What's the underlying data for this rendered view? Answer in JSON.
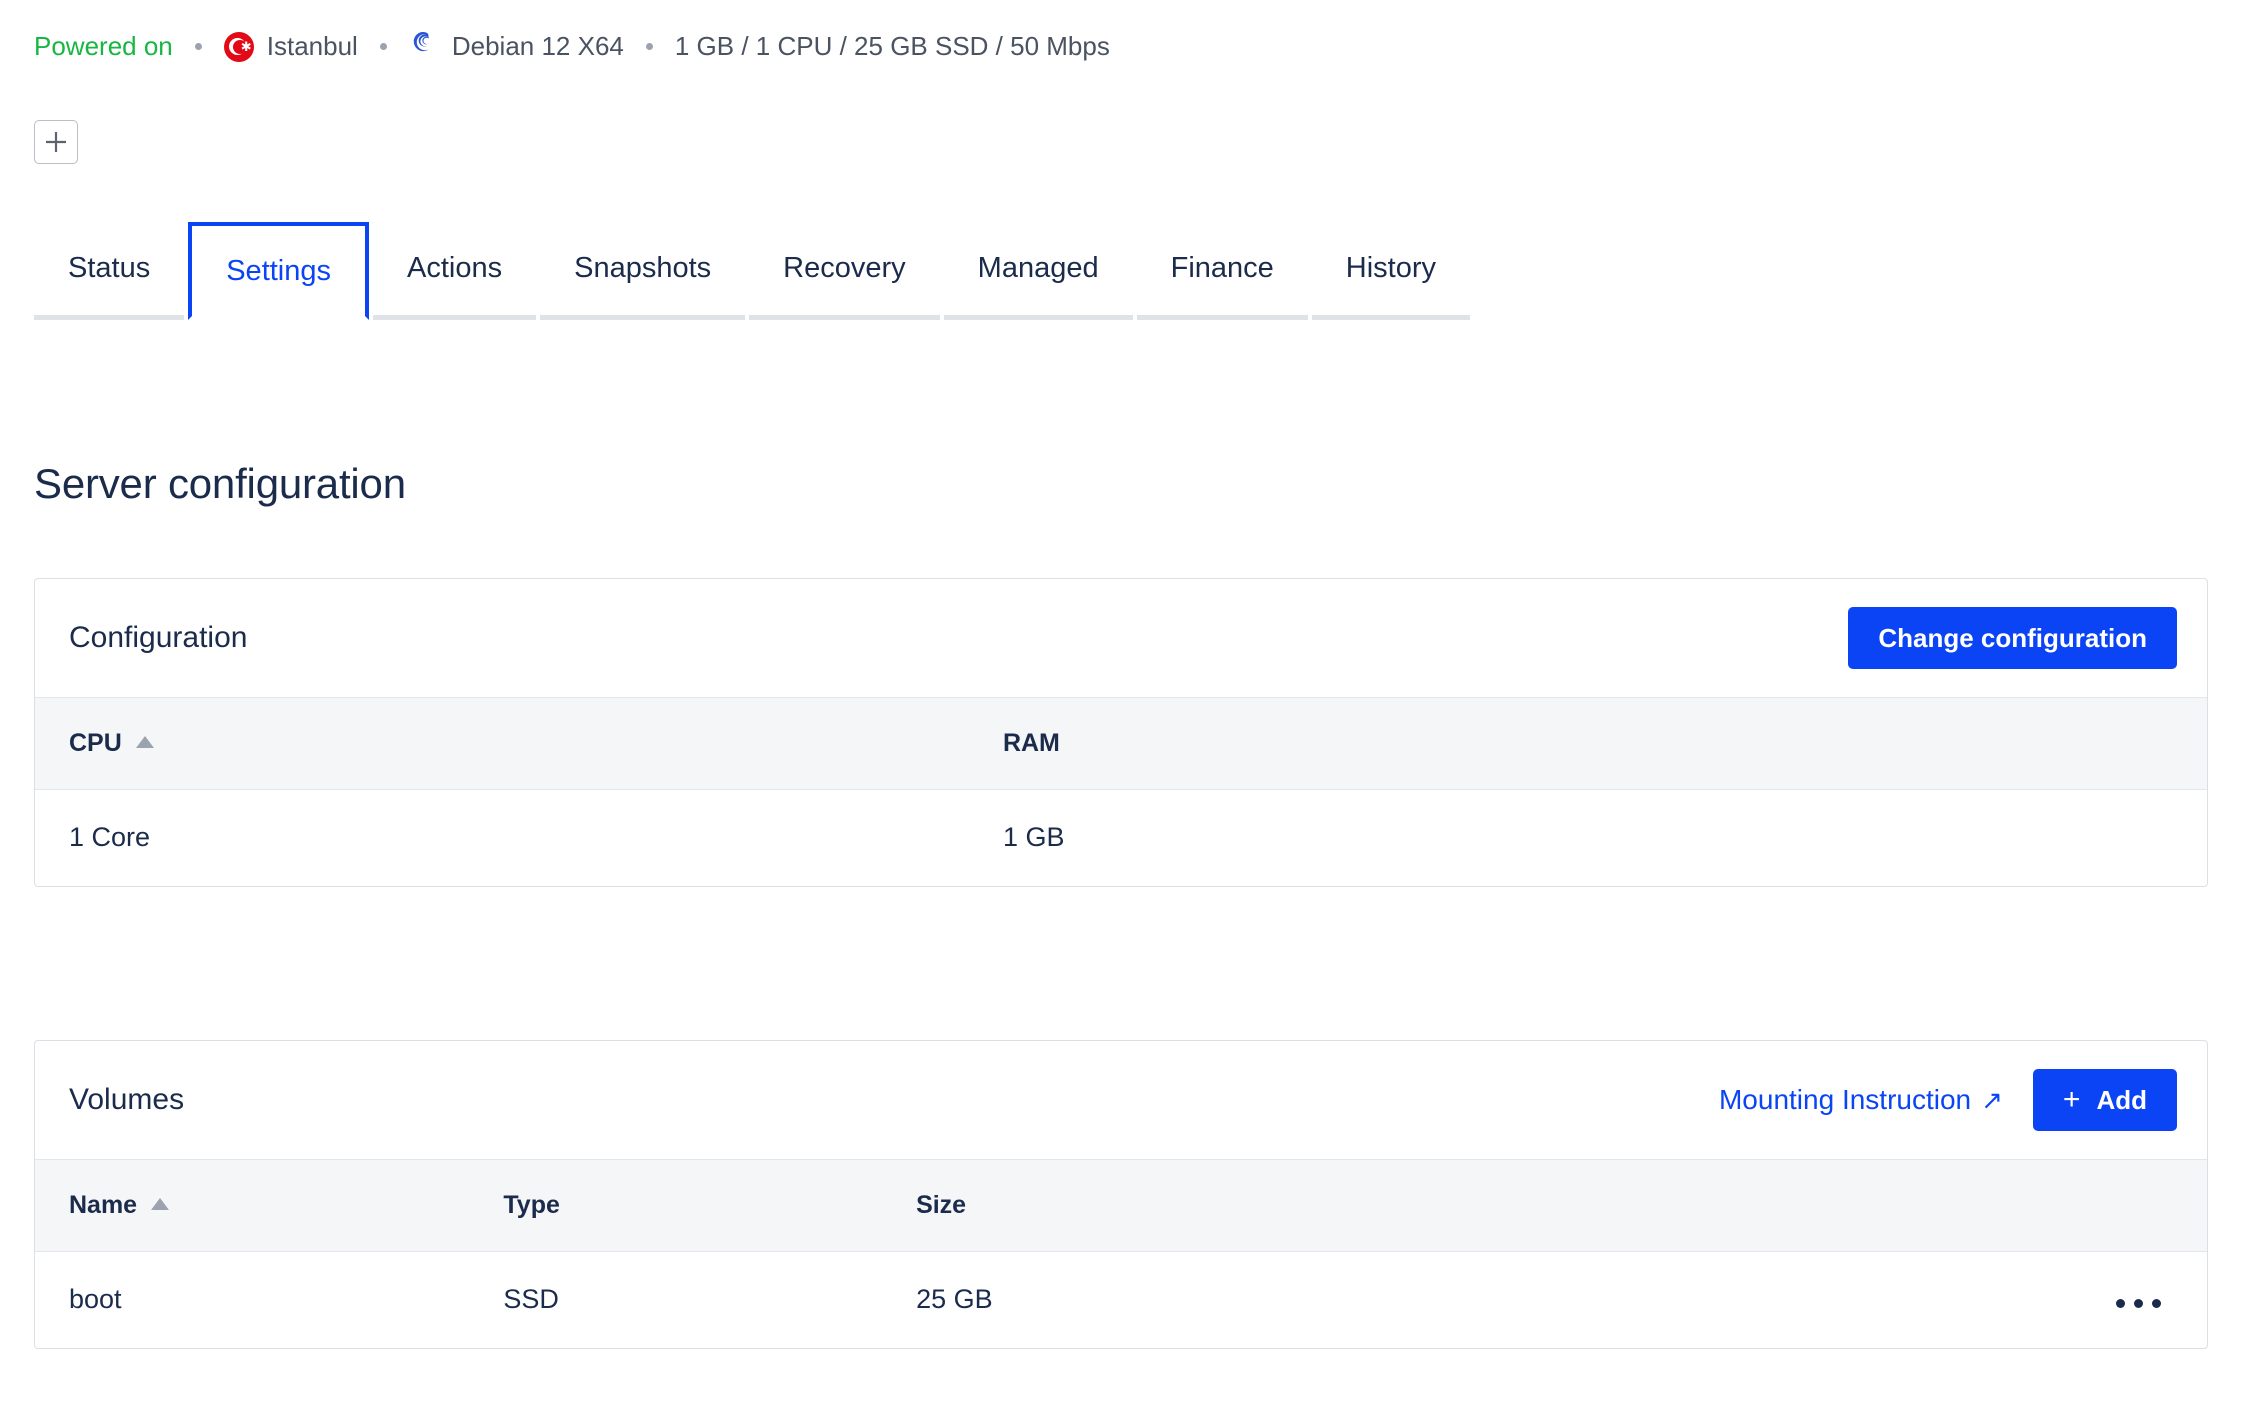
{
  "status_bar": {
    "power_state": "Powered on",
    "region": "Istanbul",
    "region_icon": "turkey-flag-icon",
    "os": "Debian 12 X64",
    "os_icon": "debian-logo-icon",
    "specs": "1 GB / 1 CPU / 25 GB SSD / 50 Mbps"
  },
  "toolbar": {
    "add_tag_label": "+",
    "add_tag_icon": "plus-icon"
  },
  "tabs": [
    {
      "label": "Status",
      "active": false
    },
    {
      "label": "Settings",
      "active": true
    },
    {
      "label": "Actions",
      "active": false
    },
    {
      "label": "Snapshots",
      "active": false
    },
    {
      "label": "Recovery",
      "active": false
    },
    {
      "label": "Managed",
      "active": false
    },
    {
      "label": "Finance",
      "active": false
    },
    {
      "label": "History",
      "active": false
    }
  ],
  "page_title": "Server configuration",
  "configuration_card": {
    "title": "Configuration",
    "change_button": "Change configuration",
    "columns": [
      "CPU",
      "RAM"
    ],
    "sorted_column": "CPU",
    "sort_direction": "asc",
    "rows": [
      {
        "cpu": "1 Core",
        "ram": "1 GB"
      }
    ]
  },
  "volumes_card": {
    "title": "Volumes",
    "mounting_link": "Mounting Instruction",
    "mounting_link_icon": "external-link-arrow-icon",
    "add_button": "Add",
    "add_button_icon": "plus-icon",
    "columns": [
      "Name",
      "Type",
      "Size"
    ],
    "sorted_column": "Name",
    "sort_direction": "asc",
    "rows": [
      {
        "name": "boot",
        "type": "SSD",
        "size": "25 GB",
        "menu_icon": "kebab-menu-icon"
      }
    ]
  },
  "colors": {
    "accent": "#0b44f5",
    "powered_on": "#18b642",
    "flag_red": "#e30a17",
    "text": "#1b2b4b",
    "muted": "#4a5361",
    "table_header_bg": "#f5f6f8",
    "border": "#dcdfe4"
  }
}
